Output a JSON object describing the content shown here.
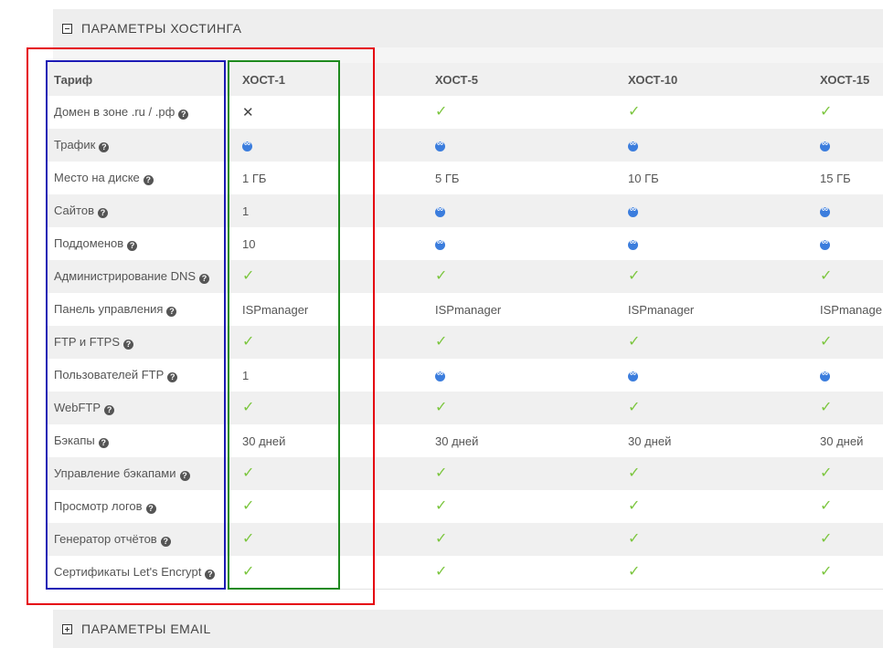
{
  "sections": {
    "hosting_title": "ПАРАМЕТРЫ ХОСТИНГА",
    "email_title": "ПАРАМЕТРЫ EMAIL"
  },
  "table": {
    "header": [
      "Тариф",
      "ХОСТ-1",
      "ХОСТ-5",
      "ХОСТ-10",
      "ХОСТ-15"
    ],
    "rows": [
      {
        "label": "Домен в зоне .ru / .рф",
        "help": true,
        "cells": [
          {
            "t": "cross"
          },
          {
            "t": "check"
          },
          {
            "t": "check"
          },
          {
            "t": "check"
          }
        ]
      },
      {
        "label": "Трафик",
        "help": true,
        "cells": [
          {
            "t": "infinity"
          },
          {
            "t": "infinity"
          },
          {
            "t": "infinity"
          },
          {
            "t": "infinity"
          }
        ]
      },
      {
        "label": "Место на диске",
        "help": true,
        "cells": [
          {
            "t": "text",
            "v": "1 ГБ"
          },
          {
            "t": "text",
            "v": "5 ГБ"
          },
          {
            "t": "text",
            "v": "10 ГБ"
          },
          {
            "t": "text",
            "v": "15 ГБ"
          }
        ]
      },
      {
        "label": "Сайтов",
        "help": true,
        "cells": [
          {
            "t": "text",
            "v": "1"
          },
          {
            "t": "infinity"
          },
          {
            "t": "infinity"
          },
          {
            "t": "infinity"
          }
        ]
      },
      {
        "label": "Поддоменов",
        "help": true,
        "cells": [
          {
            "t": "text",
            "v": "10"
          },
          {
            "t": "infinity"
          },
          {
            "t": "infinity"
          },
          {
            "t": "infinity"
          }
        ]
      },
      {
        "label": "Администрирование DNS",
        "help": true,
        "cells": [
          {
            "t": "check"
          },
          {
            "t": "check"
          },
          {
            "t": "check"
          },
          {
            "t": "check"
          }
        ]
      },
      {
        "label": "Панель управления",
        "help": true,
        "cells": [
          {
            "t": "text",
            "v": "ISPmanager"
          },
          {
            "t": "text",
            "v": "ISPmanager"
          },
          {
            "t": "text",
            "v": "ISPmanager"
          },
          {
            "t": "text",
            "v": "ISPmanage"
          }
        ]
      },
      {
        "label": "FTP и FTPS",
        "help": true,
        "cells": [
          {
            "t": "check"
          },
          {
            "t": "check"
          },
          {
            "t": "check"
          },
          {
            "t": "check"
          }
        ]
      },
      {
        "label": "Пользователей FTP",
        "help": true,
        "cells": [
          {
            "t": "text",
            "v": "1"
          },
          {
            "t": "infinity"
          },
          {
            "t": "infinity"
          },
          {
            "t": "infinity"
          }
        ]
      },
      {
        "label": "WebFTP",
        "help": true,
        "cells": [
          {
            "t": "check"
          },
          {
            "t": "check"
          },
          {
            "t": "check"
          },
          {
            "t": "check"
          }
        ]
      },
      {
        "label": "Бэкапы",
        "help": true,
        "cells": [
          {
            "t": "text",
            "v": "30 дней"
          },
          {
            "t": "text",
            "v": "30 дней"
          },
          {
            "t": "text",
            "v": "30 дней"
          },
          {
            "t": "text",
            "v": "30 дней"
          }
        ]
      },
      {
        "label": "Управление бэкапами",
        "help": true,
        "cells": [
          {
            "t": "check"
          },
          {
            "t": "check"
          },
          {
            "t": "check"
          },
          {
            "t": "check"
          }
        ]
      },
      {
        "label": "Просмотр логов",
        "help": true,
        "cells": [
          {
            "t": "check"
          },
          {
            "t": "check"
          },
          {
            "t": "check"
          },
          {
            "t": "check"
          }
        ]
      },
      {
        "label": "Генератор отчётов",
        "help": true,
        "cells": [
          {
            "t": "check"
          },
          {
            "t": "check"
          },
          {
            "t": "check"
          },
          {
            "t": "check"
          }
        ]
      },
      {
        "label": "Сертификаты Let's Encrypt",
        "help": true,
        "cells": [
          {
            "t": "check"
          },
          {
            "t": "check"
          },
          {
            "t": "check"
          },
          {
            "t": "check"
          }
        ]
      }
    ]
  },
  "icons": {
    "help": "question-circle-icon",
    "check": "check-icon",
    "cross": "cross-icon",
    "infinity": "infinity-icon",
    "collapse": "minus-square-icon",
    "expand": "plus-square-icon"
  },
  "colors": {
    "check": "#7cc63f",
    "infinity": "#3b7ddd",
    "highlight_red": "#e5000e",
    "highlight_blue": "#1d1bb5",
    "highlight_green": "#1e8a1e"
  }
}
